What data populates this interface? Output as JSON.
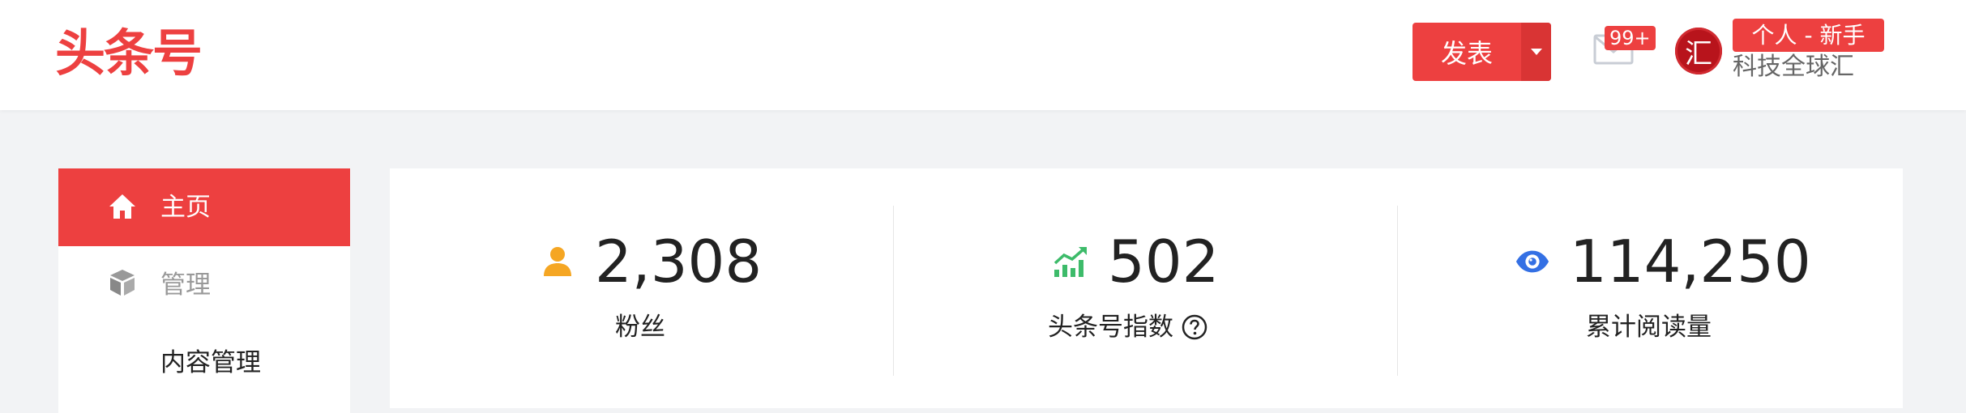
{
  "header": {
    "logo": "头条号",
    "publish_label": "发表",
    "message_badge": "99+",
    "avatar_text": "汇",
    "level_badge": "个人 - 新手",
    "username": "科技全球汇",
    "icons": [
      "dropdown-caret-icon",
      "mail-icon"
    ],
    "accent_color": "#ed4040"
  },
  "sidebar": {
    "items": [
      {
        "label": "主页",
        "icon": "home-icon",
        "active": true
      },
      {
        "label": "管理",
        "icon": "cube-icon",
        "active": false
      },
      {
        "label": "内容管理",
        "icon": "",
        "active": false
      }
    ]
  },
  "stats": [
    {
      "value": "2,308",
      "label": "粉丝",
      "icon": "user-icon",
      "color": "#f5a623"
    },
    {
      "value": "502",
      "label": "头条号指数",
      "icon": "trend-up-icon",
      "color": "#3dbb6a",
      "help_icon": "question-circle-icon"
    },
    {
      "value": "114,250",
      "label": "累计阅读量",
      "icon": "eye-icon",
      "color": "#3470e4"
    }
  ]
}
